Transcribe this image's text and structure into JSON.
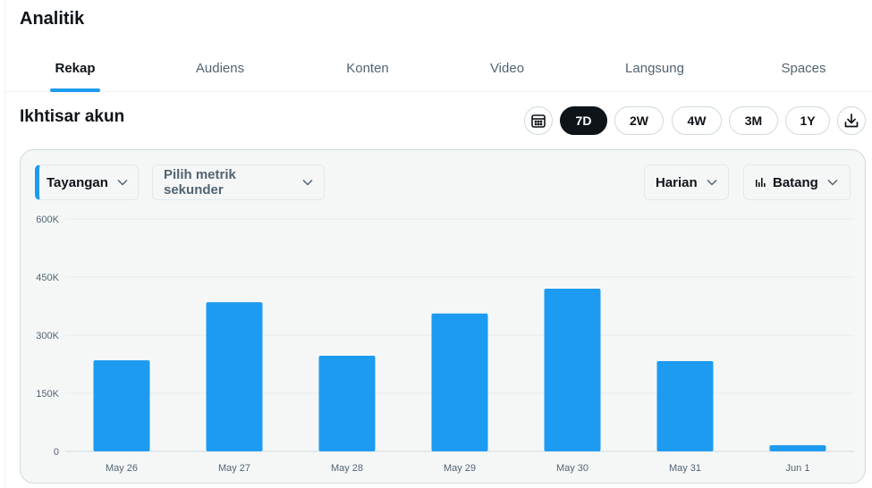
{
  "header": {
    "title": "Analitik"
  },
  "tabs": [
    {
      "label": "Rekap",
      "active": true
    },
    {
      "label": "Audiens",
      "active": false
    },
    {
      "label": "Konten",
      "active": false
    },
    {
      "label": "Video",
      "active": false
    },
    {
      "label": "Langsung",
      "active": false
    },
    {
      "label": "Spaces",
      "active": false
    }
  ],
  "overview": {
    "title": "Ikhtisar akun",
    "calendar_icon": "calendar-icon",
    "download_icon": "download-icon",
    "ranges": [
      {
        "label": "7D",
        "active": true
      },
      {
        "label": "2W",
        "active": false
      },
      {
        "label": "4W",
        "active": false
      },
      {
        "label": "3M",
        "active": false
      },
      {
        "label": "1Y",
        "active": false
      }
    ]
  },
  "controls": {
    "primary_metric": "Tayangan",
    "secondary_metric": "Pilih metrik sekunder",
    "interval": "Harian",
    "chart_style": "Batang",
    "chart_style_icon": "bar-chart-icon"
  },
  "colors": {
    "accent": "#1d9bf0",
    "active_range_bg": "#0f1419",
    "panel_bg": "#f5f7f7"
  },
  "chart_data": {
    "type": "bar",
    "categories": [
      "May 26",
      "May 27",
      "May 28",
      "May 29",
      "May 30",
      "May 31",
      "Jun 1"
    ],
    "series": [
      {
        "values": [
          235000,
          385000,
          247000,
          356000,
          420000,
          233000,
          16000
        ]
      }
    ],
    "yticks": [
      "0",
      "150K",
      "300K",
      "450K",
      "600K"
    ],
    "ytick_values": [
      0,
      150000,
      300000,
      450000,
      600000
    ],
    "ylim": [
      0,
      600000
    ],
    "grid": true,
    "color": "#1d9bf0"
  }
}
